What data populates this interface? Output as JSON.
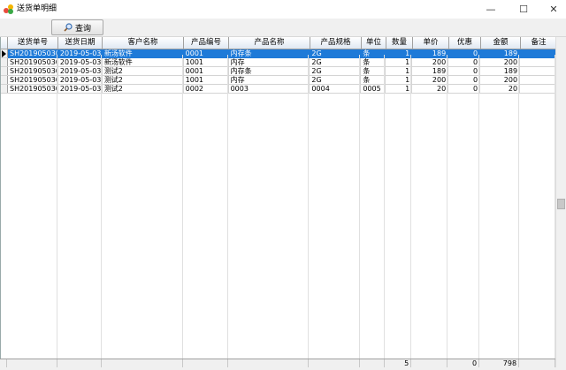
{
  "window": {
    "title": "送货单明细",
    "minimize_glyph": "—",
    "maximize_glyph": "☐",
    "close_glyph": "✕"
  },
  "toolbar": {
    "query_label": "查询",
    "query_icon": "magnifier-icon"
  },
  "colors": {
    "selection": "#1e7ad8",
    "header_gradient_end": "#dfe8f3"
  },
  "table": {
    "columns": [
      "送货单号",
      "送货日期",
      "客户名称",
      "产品编号",
      "产品名称",
      "产品规格",
      "单位",
      "数量",
      "单价",
      "优惠",
      "金额",
      "备注"
    ],
    "rows": [
      [
        "SH20190503001",
        "2019-05-03",
        "新汤软件",
        "0001",
        "内存条",
        "2G",
        "条",
        "1",
        "189",
        "0",
        "189",
        ""
      ],
      [
        "SH20190503001",
        "2019-05-03",
        "新汤软件",
        "1001",
        "内存",
        "2G",
        "条",
        "1",
        "200",
        "0",
        "200",
        ""
      ],
      [
        "SH20190503002",
        "2019-05-03",
        "测试2",
        "0001",
        "内存条",
        "2G",
        "条",
        "1",
        "189",
        "0",
        "189",
        ""
      ],
      [
        "SH20190503002",
        "2019-05-03",
        "测试2",
        "1001",
        "内存",
        "2G",
        "条",
        "1",
        "200",
        "0",
        "200",
        ""
      ],
      [
        "SH20190503002",
        "2019-05-03",
        "测试2",
        "0002",
        "0003",
        "0004",
        "0005",
        "1",
        "20",
        "0",
        "20",
        ""
      ]
    ],
    "selected_row": 0,
    "totals": {
      "quantity": "5",
      "discount": "0",
      "amount": "798"
    }
  }
}
